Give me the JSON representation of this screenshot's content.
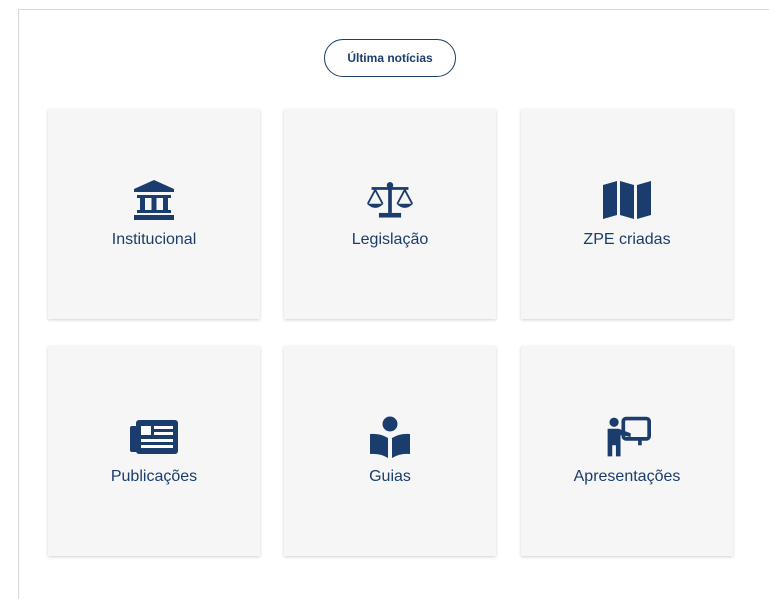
{
  "news_button": {
    "label": "Última notícias"
  },
  "cards": [
    {
      "label": "Institucional",
      "icon": "institution-icon"
    },
    {
      "label": "Legislação",
      "icon": "scales-icon"
    },
    {
      "label": "ZPE criadas",
      "icon": "map-icon"
    },
    {
      "label": "Publicações",
      "icon": "newspaper-icon"
    },
    {
      "label": "Guias",
      "icon": "book-reader-icon"
    },
    {
      "label": "Apresentações",
      "icon": "presenter-icon"
    }
  ],
  "colors": {
    "primary": "#1b3d6d",
    "card_bg": "#f6f6f6"
  }
}
